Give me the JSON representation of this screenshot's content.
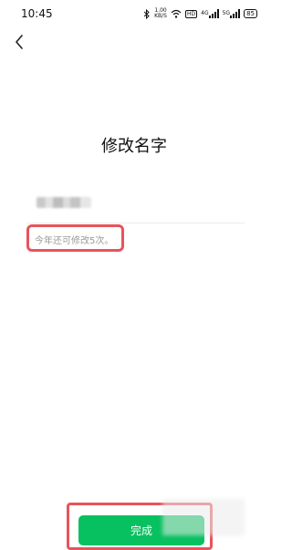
{
  "status_bar": {
    "time": "10:45",
    "speed_value": "1.00",
    "speed_unit": "KB/S",
    "hd_label": "HD",
    "signal1_label": "4G",
    "signal2_label": "5G",
    "battery": "85"
  },
  "header": {
    "back_icon": "chevron-left-icon"
  },
  "main": {
    "title": "修改名字",
    "name_value_obscured": true,
    "hint": "今年还可修改5次。"
  },
  "footer": {
    "done_label": "完成"
  },
  "colors": {
    "accent": "#07c160",
    "highlight": "#e7545b"
  }
}
